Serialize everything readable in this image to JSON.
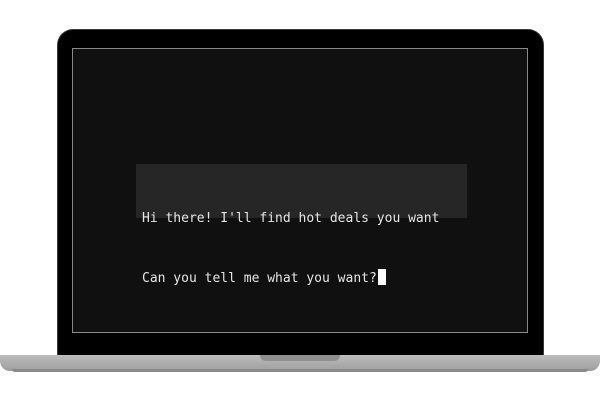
{
  "terminal": {
    "lines": [
      "Hi there! I'll find hot deals you want",
      "Can you tell me what you want?"
    ]
  }
}
